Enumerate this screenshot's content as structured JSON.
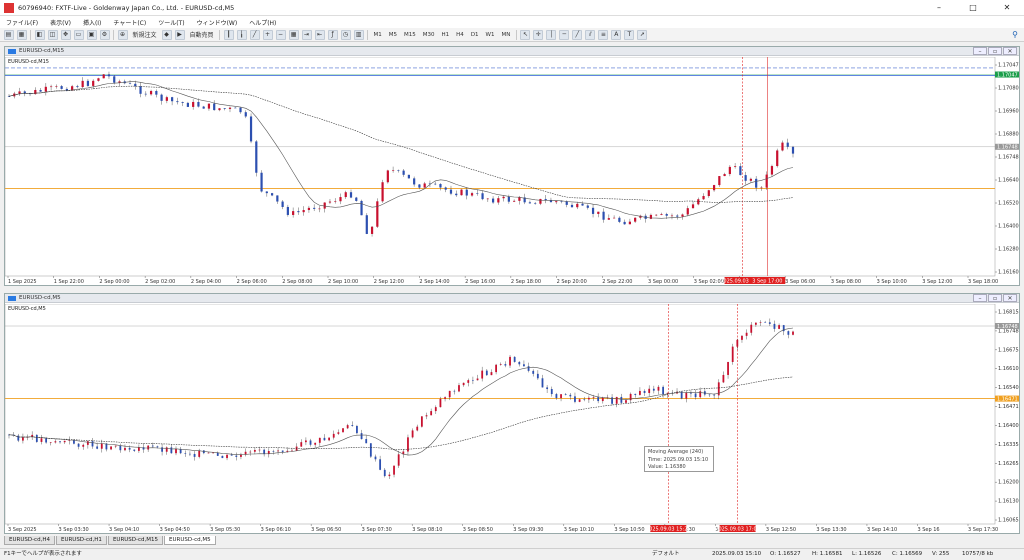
{
  "window": {
    "title": "60796940: FXTF-Live - Goldenway Japan Co., Ltd. - EURUSD-cd,M5"
  },
  "menu": [
    "ファイル(F)",
    "表示(V)",
    "挿入(I)",
    "チャート(C)",
    "ツール(T)",
    "ウィンドウ(W)",
    "ヘルプ(H)"
  ],
  "toolbar": {
    "new_order_label": "新規注文",
    "auto_trade_label": "自動売買",
    "timeframes": [
      "M1",
      "M5",
      "M15",
      "M30",
      "H1",
      "H4",
      "D1",
      "W1",
      "MN"
    ]
  },
  "chart1": {
    "title": "EURUSD-cd,M15",
    "symbol_label": "EURUSD-cd,M15",
    "price_labels": [
      "1.17047",
      "1.17080",
      "1.16960",
      "1.16880",
      "1.16748",
      "1.16640",
      "1.16520",
      "1.16400",
      "1.16280",
      "1.16160"
    ],
    "time_labels": [
      "1 Sep 2025",
      "1 Sep 22:00",
      "2 Sep 00:00",
      "2 Sep 02:00",
      "2 Sep 04:00",
      "2 Sep 06:00",
      "2 Sep 08:00",
      "2 Sep 10:00",
      "2 Sep 12:00",
      "2 Sep 14:00",
      "2 Sep 16:00",
      "2 Sep 18:00",
      "2 Sep 20:00",
      "2 Sep 22:00",
      "3 Sep 00:00",
      "3 Sep 02:00",
      "3 Sep 04:00",
      "3 Sep 06:00",
      "3 Sep 08:00",
      "3 Sep 10:00",
      "3 Sep 12:00",
      "3 Sep 18:00"
    ],
    "marker_time": "2025.09.03 15:10",
    "marker_time2": "3 Sep 17:00"
  },
  "chart2": {
    "title": "EURUSD-cd,M5",
    "symbol_label": "EURUSD-cd,M5",
    "price_labels": [
      "1.16815",
      "1.16748",
      "1.16675",
      "1.16610",
      "1.16540",
      "1.16471",
      "1.16400",
      "1.16335",
      "1.16265",
      "1.16200",
      "1.16130",
      "1.16065"
    ],
    "time_labels": [
      "3 Sep 2025",
      "3 Sep 03:30",
      "3 Sep 04:10",
      "3 Sep 04:50",
      "3 Sep 05:30",
      "3 Sep 06:10",
      "3 Sep 06:50",
      "3 Sep 07:30",
      "3 Sep 08:10",
      "3 Sep 08:50",
      "3 Sep 09:30",
      "3 Sep 10:10",
      "3 Sep 10:50",
      "3 Sep 11:30",
      "3 Sep 12:10",
      "3 Sep 12:50",
      "3 Sep 13:30",
      "3 Sep 14:10",
      "3 Sep 16",
      "3 Sep 17:30"
    ],
    "marker_time": "2025.09.03 15:25",
    "marker_time2": "2025.09.03 17:00"
  },
  "tooltip": {
    "line1": "Moving Average (240)",
    "line2": "Time: 2025.09.03 15:10",
    "line3": "Value: 1.16380"
  },
  "tabs": [
    "EURUSD-cd,H4",
    "EURUSD-cd,H1",
    "EURUSD-cd,M15",
    "EURUSD-cd,M5"
  ],
  "status": {
    "help": "F1キーでヘルプが表示されます",
    "profile": "デフォルト",
    "datetime": "2025.09.03 15:10",
    "open": "O: 1.16527",
    "high": "H: 1.16581",
    "low": "L: 1.16526",
    "close": "C: 1.16569",
    "volume": "V: 255",
    "traffic": "10757/8 kb"
  }
}
